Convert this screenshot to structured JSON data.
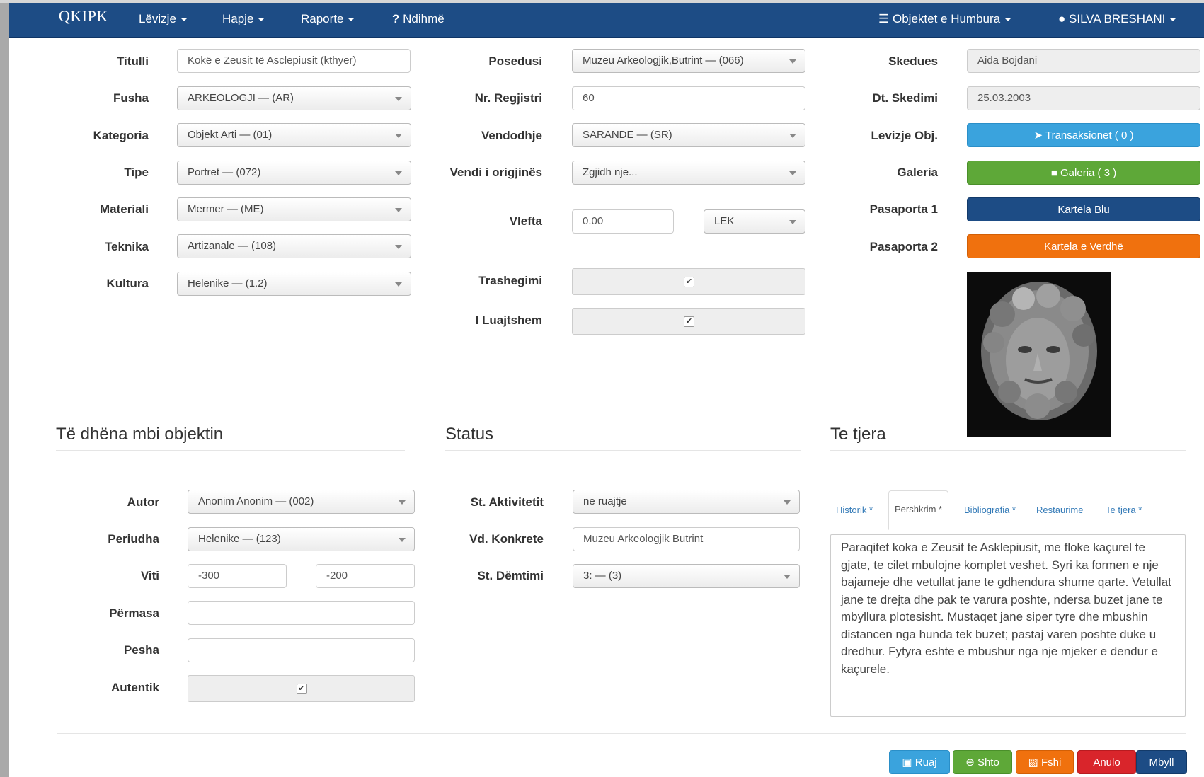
{
  "nav": {
    "brand": "QKIPK",
    "menu": [
      "Lëvizje",
      "Hapje",
      "Raporte",
      "Ndihmë"
    ],
    "right": [
      "Objektet e Humbura",
      "SILVA BRESHANI"
    ]
  },
  "col1": {
    "labels": [
      "Titulli",
      "Fusha",
      "Kategoria",
      "Tipe",
      "Materiali",
      "Teknika",
      "Kultura"
    ],
    "titulli": "Kokë e Zeusit të Asclepiusit (kthyer)",
    "selects": [
      "ARKEOLOGJI — (AR)",
      "Objekt Arti — (01)",
      "Portret — (072)",
      "Mermer — (ME)",
      "Artizanale — (108)",
      "Helenike — (1.2)"
    ]
  },
  "col2": {
    "labels": [
      "Posedusi",
      "Nr. Regjistri",
      "Vendodhje",
      "Vendi i origjinës",
      "Vlefta",
      "Trashegimi",
      "I Luajtshem"
    ],
    "posedusi": "Muzeu Arkeologjik,Butrint — (066)",
    "nr_regjistri": "60",
    "vendodhje": "SARANDE — (SR)",
    "vendi_origjines": "Zgjidh nje...",
    "vlefta": "0.00",
    "currency": "LEK",
    "trashegimi_checked": true,
    "luajtshem_checked": true
  },
  "col3": {
    "labels": [
      "Skedues",
      "Dt. Skedimi",
      "Levizje Obj.",
      "Galeria",
      "Pasaporta 1",
      "Pasaporta 2"
    ],
    "skedues": "Aida Bojdani",
    "dt_skedimi": "25.03.2003",
    "transaksionet": "Transaksionet ( 0 )",
    "galeria": "Galeria ( 3 )",
    "pasaporta1": "Kartela Blu",
    "pasaporta2": "Kartela e Verdhë",
    "colors": {
      "info": "#3aa3dd",
      "success": "#5ea838",
      "primary": "#1d4c85",
      "warning": "#f0710e"
    }
  },
  "sections": {
    "objekt_title": "Të dhëna mbi objektin",
    "status_title": "Status",
    "tjera_title": "Te tjera"
  },
  "objekt": {
    "labels": [
      "Autor",
      "Periudha",
      "Viti",
      "Përmasa",
      "Pesha",
      "Autentik"
    ],
    "autor": "Anonim Anonim — (002)",
    "periudha": "Helenike — (123)",
    "viti_from": "-300",
    "viti_to": "-200",
    "permasa": "",
    "pesha": "",
    "autentik_checked": true
  },
  "status": {
    "labels": [
      "St. Aktivitetit",
      "Vd. Konkrete",
      "St. Dëmtimi"
    ],
    "aktivitetit": "ne ruajtje",
    "konkrete": "Muzeu Arkeologjik Butrint",
    "demtimi": "3: — (3)"
  },
  "tjera": {
    "tabs": [
      "Historik *",
      "Pershkrim *",
      "Bibliografia *",
      "Restaurime",
      "Te tjera *"
    ],
    "active_tab": "Pershkrim *",
    "text": "Paraqitet koka e Zeusit te Asklepiusit, me floke kaçurel te gjate, te cilet mbulojne komplet veshet. Syri ka formen e nje bajameje dhe vetullat jane te gdhendura shume qarte. Vetullat jane te drejta dhe pak te varura poshte, ndersa buzet jane te mbyllura plotesisht. Mustaqet jane siper tyre dhe mbushin distancen nga hunda tek buzet; pastaj varen poshte duke u dredhur. Fytyra eshte e mbushur nga nje mjeker e dendur e kaçurele."
  },
  "actions": {
    "ruaj": "Ruaj",
    "shto": "Shto",
    "fshi": "Fshi",
    "anulo": "Anulo",
    "mbyll": "Mbyll"
  },
  "icons": [
    "caret-icon",
    "help-icon",
    "database-icon",
    "user-icon",
    "paper-plane-icon",
    "video-camera-icon",
    "save-icon",
    "plus-circle-icon",
    "trash-icon",
    "checkbox-icon"
  ]
}
